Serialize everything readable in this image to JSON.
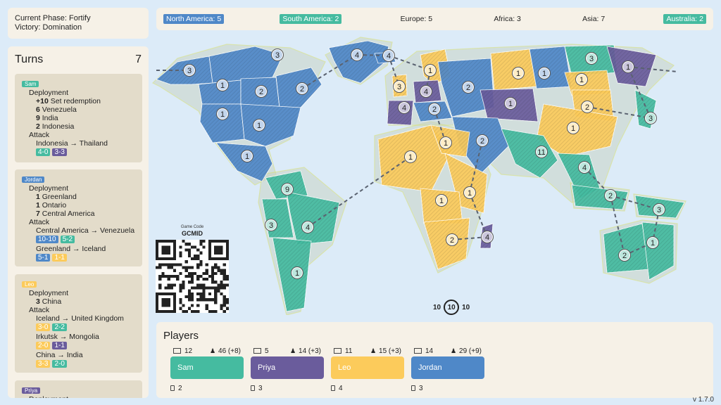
{
  "phase": {
    "label_phase": "Current Phase: Fortify",
    "label_victory": "Victory: Domination"
  },
  "turns": {
    "title": "Turns",
    "count": "7",
    "entries": [
      {
        "player": "Sam",
        "deployment_label": "Deployment",
        "deployments": [
          {
            "n": "+10",
            "t": "Set redemption"
          },
          {
            "n": "6",
            "t": "Venezuela"
          },
          {
            "n": "9",
            "t": "India"
          },
          {
            "n": "2",
            "t": "Indonesia"
          }
        ],
        "attack_label": "Attack",
        "attacks": [
          {
            "route": "Indonesia → Thailand",
            "dice": [
              "4-0",
              "3-3"
            ]
          }
        ]
      },
      {
        "player": "Jordan",
        "deployment_label": "Deployment",
        "deployments": [
          {
            "n": "1",
            "t": "Greenland"
          },
          {
            "n": "1",
            "t": "Ontario"
          },
          {
            "n": "7",
            "t": "Central America"
          }
        ],
        "attack_label": "Attack",
        "attacks": [
          {
            "route": "Central America → Venezuela",
            "dice": [
              "10-10",
              "5-2"
            ]
          },
          {
            "route": "Greenland → Iceland",
            "dice": [
              "5-1",
              "1-1"
            ]
          }
        ]
      },
      {
        "player": "Leo",
        "deployment_label": "Deployment",
        "deployments": [
          {
            "n": "3",
            "t": "China"
          }
        ],
        "attack_label": "Attack",
        "attacks": [
          {
            "route": "Iceland → United Kingdom",
            "dice": [
              "3-0",
              "2-2"
            ]
          },
          {
            "route": "Irkutsk → Mongolia",
            "dice": [
              "2-0",
              "1-1"
            ]
          },
          {
            "route": "China → India",
            "dice": [
              "3-3",
              "2-0"
            ]
          }
        ]
      },
      {
        "player": "Priya",
        "deployment_label": "Deployment",
        "deployments": [],
        "attack_label": "",
        "attacks": []
      }
    ]
  },
  "continents": [
    {
      "label": "North America: 5",
      "owner": "Jordan"
    },
    {
      "label": "South America: 2",
      "owner": "Sam"
    },
    {
      "label": "Europe: 5",
      "owner": ""
    },
    {
      "label": "Africa: 3",
      "owner": ""
    },
    {
      "label": "Asia: 7",
      "owner": ""
    },
    {
      "label": "Australia: 2",
      "owner": "Sam"
    }
  ],
  "game_code": {
    "label": "Game Code",
    "code": "GCMID"
  },
  "reinforce": {
    "left": "10",
    "center": "10",
    "right": "10"
  },
  "players": {
    "title": "Players",
    "list": [
      {
        "name": "Sam",
        "territories": "12",
        "armies": "46 (+8)",
        "cards": "2",
        "color": "#45bba0"
      },
      {
        "name": "Priya",
        "territories": "5",
        "armies": "14 (+3)",
        "cards": "3",
        "color": "#6a5c9c"
      },
      {
        "name": "Leo",
        "territories": "11",
        "armies": "15 (+3)",
        "cards": "4",
        "color": "#fccb5b"
      },
      {
        "name": "Jordan",
        "territories": "14",
        "armies": "29 (+9)",
        "cards": "3",
        "color": "#4f88c8"
      }
    ]
  },
  "colors": {
    "Sam": "#45bba0",
    "Priya": "#6a5c9c",
    "Leo": "#fccb5b",
    "Jordan": "#4f88c8",
    "neutral": "#e8a94a",
    "ocean": "#dcebf8"
  },
  "map_territories": [
    {
      "name": "Alaska",
      "armies": "3",
      "owner": "Jordan"
    },
    {
      "name": "Northwest Territory",
      "armies": "3",
      "owner": "Jordan"
    },
    {
      "name": "Greenland",
      "armies": "4",
      "owner": "Jordan"
    },
    {
      "name": "Alberta",
      "armies": "1",
      "owner": "Jordan"
    },
    {
      "name": "Ontario",
      "armies": "2",
      "owner": "Jordan"
    },
    {
      "name": "Quebec",
      "armies": "2",
      "owner": "Jordan"
    },
    {
      "name": "Western United States",
      "armies": "1",
      "owner": "Jordan"
    },
    {
      "name": "Eastern United States",
      "armies": "1",
      "owner": "Jordan"
    },
    {
      "name": "Central America",
      "armies": "1",
      "owner": "Jordan"
    },
    {
      "name": "Iceland",
      "armies": "4",
      "owner": "Jordan"
    },
    {
      "name": "Scandinavia",
      "armies": "1",
      "owner": "Leo"
    },
    {
      "name": "Great Britain",
      "armies": "3",
      "owner": "Leo"
    },
    {
      "name": "Northern Europe",
      "armies": "4",
      "owner": "Priya"
    },
    {
      "name": "Western Europe",
      "armies": "4",
      "owner": "Priya"
    },
    {
      "name": "Southern Europe",
      "armies": "2",
      "owner": "Jordan"
    },
    {
      "name": "Ukraine",
      "armies": "2",
      "owner": "Jordan"
    },
    {
      "name": "Ural",
      "armies": "1",
      "owner": "Leo"
    },
    {
      "name": "Siberia",
      "armies": "1",
      "owner": "Jordan"
    },
    {
      "name": "Yakutsk",
      "armies": "3",
      "owner": "Sam"
    },
    {
      "name": "Kamchatka",
      "armies": "1",
      "owner": "Priya"
    },
    {
      "name": "Irkutsk",
      "armies": "1",
      "owner": "Leo"
    },
    {
      "name": "Afghanistan",
      "armies": "1",
      "owner": "Priya"
    },
    {
      "name": "Mongolia",
      "armies": "2",
      "owner": "Leo"
    },
    {
      "name": "China",
      "armies": "1",
      "owner": "Leo"
    },
    {
      "name": "Japan",
      "armies": "3",
      "owner": "Sam"
    },
    {
      "name": "Middle East",
      "armies": "2",
      "owner": "Jordan"
    },
    {
      "name": "India",
      "armies": "11",
      "owner": "Sam"
    },
    {
      "name": "Siam",
      "armies": "4",
      "owner": "Sam"
    },
    {
      "name": "Venezuela",
      "armies": "9",
      "owner": "Sam"
    },
    {
      "name": "Peru",
      "armies": "3",
      "owner": "Sam"
    },
    {
      "name": "Brazil",
      "armies": "4",
      "owner": "Sam"
    },
    {
      "name": "Argentina",
      "armies": "1",
      "owner": "Sam"
    },
    {
      "name": "North Africa",
      "armies": "1",
      "owner": "Leo"
    },
    {
      "name": "Egypt",
      "armies": "1",
      "owner": "Leo"
    },
    {
      "name": "East Africa",
      "armies": "1",
      "owner": "Leo"
    },
    {
      "name": "Congo",
      "armies": "1",
      "owner": "Leo"
    },
    {
      "name": "South Africa",
      "armies": "2",
      "owner": "Leo"
    },
    {
      "name": "Madagascar",
      "armies": "4",
      "owner": "Priya"
    },
    {
      "name": "Indonesia",
      "armies": "2",
      "owner": "Sam"
    },
    {
      "name": "New Guinea",
      "armies": "3",
      "owner": "Sam"
    },
    {
      "name": "Western Australia",
      "armies": "2",
      "owner": "Sam"
    },
    {
      "name": "Eastern Australia",
      "armies": "1",
      "owner": "Sam"
    }
  ],
  "version": "v 1.7.0"
}
